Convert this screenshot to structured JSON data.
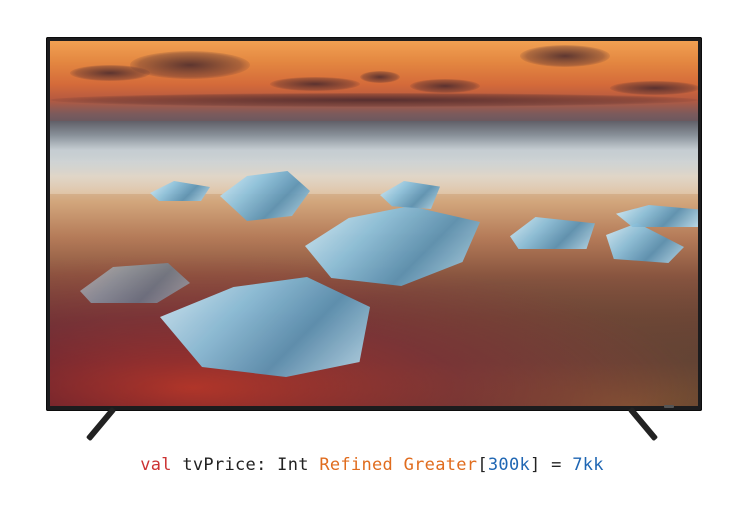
{
  "image": {
    "subject": "television",
    "screen_scene": "sunset beach with ice chunks"
  },
  "caption": {
    "keyword": "val",
    "name": " tvPrice: ",
    "type_int": "Int ",
    "refined": "Refined Greater",
    "bracket_open": "[",
    "limit": "300k",
    "bracket_close": "]",
    "equals": " = ",
    "value": "7kk"
  },
  "colors": {
    "keyword": "#cc3333",
    "refinement": "#e06c1e",
    "number": "#1f66b3",
    "text": "#222222"
  }
}
